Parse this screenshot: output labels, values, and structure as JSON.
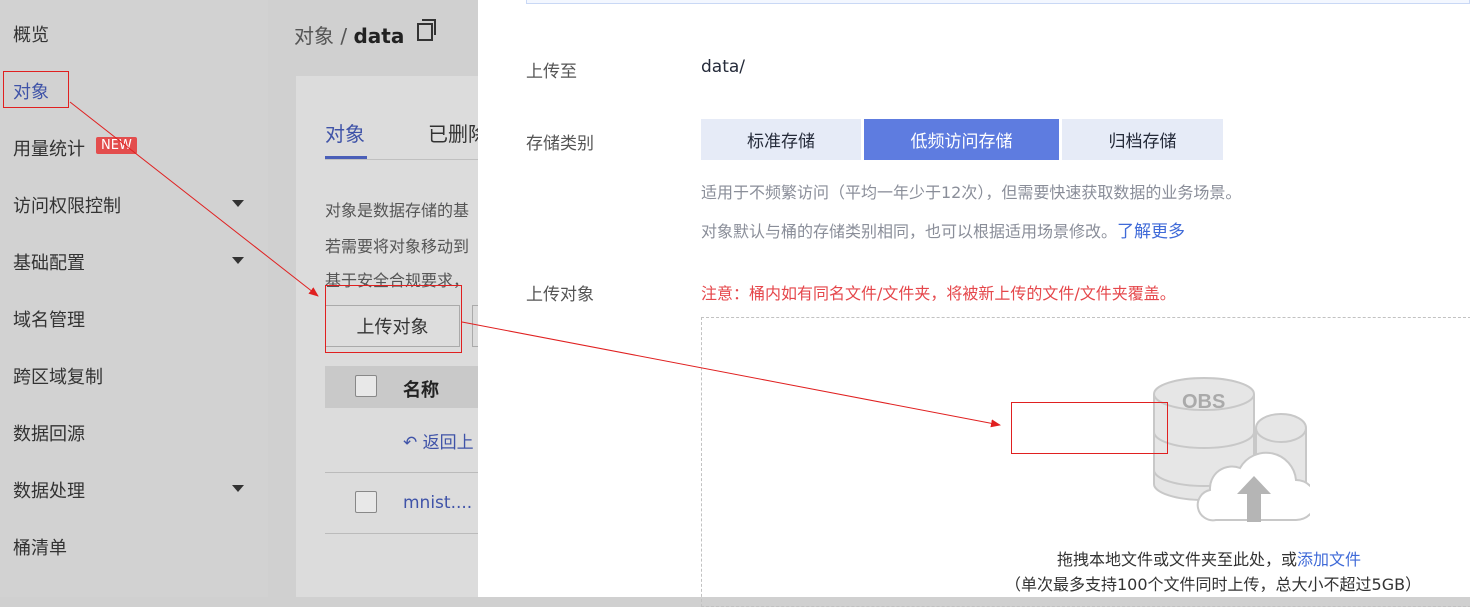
{
  "sidebar": {
    "items": [
      {
        "label": "概览"
      },
      {
        "label": "对象"
      },
      {
        "label": "用量统计"
      },
      {
        "label": "访问权限控制"
      },
      {
        "label": "基础配置"
      },
      {
        "label": "域名管理"
      },
      {
        "label": "跨区域复制"
      },
      {
        "label": "数据回源"
      },
      {
        "label": "数据处理"
      },
      {
        "label": "桶清单"
      }
    ],
    "new_badge": "NEW"
  },
  "main": {
    "breadcrumb_parent": "对象",
    "breadcrumb_sep": "/",
    "breadcrumb_current": "data",
    "tabs": [
      {
        "label": "对象"
      },
      {
        "label": "已删除"
      }
    ],
    "info_lines": [
      "对象是数据存储的基",
      "若需要将对象移动到",
      "基于安全合规要求，"
    ],
    "upload_button": "上传对象",
    "table_header_name": "名称",
    "back_link": "返回上",
    "file_name": "mnist...."
  },
  "upload_panel": {
    "upload_to_label": "上传至",
    "upload_to_value": "data/",
    "storage_class_label": "存储类别",
    "storage_classes": [
      {
        "label": "标准存储",
        "active": false
      },
      {
        "label": "低频访问存储",
        "active": true
      },
      {
        "label": "归档存储",
        "active": false
      }
    ],
    "storage_desc_1": "适用于不频繁访问（平均一年少于12次），但需要快速获取数据的业务场景。",
    "storage_desc_2": "对象默认与桶的存储类别相同，也可以根据适用场景修改。",
    "learn_more": "了解更多",
    "upload_object_label": "上传对象",
    "warning": "注意：桶内如有同名文件/文件夹，将被新上传的文件/文件夹覆盖。",
    "obs_icon_text": "OBS",
    "drop_text": "拖拽本地文件或文件夹至此处，或",
    "add_file_link": "添加文件",
    "drop_hint": "（单次最多支持100个文件同时上传，总大小不超过5GB）"
  },
  "colors": {
    "accent": "#5e7ce0",
    "link": "#3f6ad8",
    "warning": "#e5474b",
    "annotation": "#e02020"
  }
}
